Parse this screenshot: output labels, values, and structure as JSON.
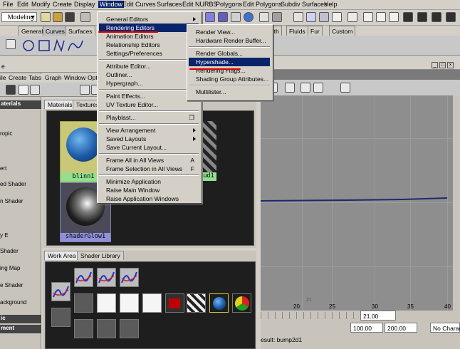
{
  "menubar": {
    "items": [
      "File",
      "Edit",
      "Modify",
      "Create",
      "Display",
      "Window",
      "Edit Curves",
      "Surfaces",
      "Edit NURBS",
      "Polygons",
      "Edit Polygons",
      "Subdiv Surfaces",
      "Help"
    ],
    "active_index": 5
  },
  "toolbar": {
    "mode": "Modeling"
  },
  "shelf_tabs": {
    "left": [
      "General",
      "Curves",
      "Surfaces"
    ],
    "right": [
      "oth",
      "Fluids",
      "Fur",
      "Custom"
    ],
    "selected_index": 1
  },
  "left_panel": {
    "header": "aterials",
    "items": [
      "ropic",
      "ert",
      "ed Shader",
      "n Shader",
      "y E",
      "Shader",
      "ing Map",
      "e Shader",
      "ackground"
    ],
    "footer1": "ic",
    "footer2": "ment"
  },
  "hypershade": {
    "menus": [
      "ile",
      "Create",
      "Tabs",
      "Graph",
      "Window",
      "Opt"
    ],
    "upper_tabs": [
      "Materials",
      "Textures"
    ],
    "lower_tabs": [
      "Work Area",
      "Shader Library"
    ],
    "swatches": {
      "blinn": "blinn1",
      "glow": "shaderGlow1",
      "partial": "ud1"
    }
  },
  "graph_editor": {
    "ticks": [
      "20",
      "25",
      "30",
      "35",
      "40"
    ],
    "tick_extra": "21",
    "frame_field": "21.00",
    "start": "100.00",
    "end": "200.00",
    "right_field": "No Charact",
    "status": "esult: bump2d1"
  },
  "window_menu": {
    "items": [
      {
        "label": "General Editors",
        "sub": true
      },
      {
        "label": "Rendering Editors",
        "sub": true,
        "hl": true
      },
      {
        "label": "Animation Editors",
        "sub": true
      },
      {
        "label": "Relationship Editors",
        "sub": true
      },
      {
        "label": "Settings/Preferences",
        "sub": true
      },
      {
        "sep": true
      },
      {
        "label": "Attribute Editor..."
      },
      {
        "label": "Outliner..."
      },
      {
        "label": "Hypergraph..."
      },
      {
        "sep": true
      },
      {
        "label": "Paint Effects..."
      },
      {
        "label": "UV Texture Editor..."
      },
      {
        "sep": true
      },
      {
        "label": "Playblast...",
        "box": true
      },
      {
        "sep": true
      },
      {
        "label": "View Arrangement",
        "sub": true
      },
      {
        "label": "Saved Layouts",
        "sub": true
      },
      {
        "label": "Save Current Layout..."
      },
      {
        "sep": true
      },
      {
        "label": "Frame All in All Views",
        "sc": "A"
      },
      {
        "label": "Frame Selection in All Views",
        "sc": "F"
      },
      {
        "sep": true
      },
      {
        "label": "Minimize Application"
      },
      {
        "label": "Raise Main Window"
      },
      {
        "label": "Raise Application Windows"
      }
    ]
  },
  "rendering_menu": {
    "items": [
      {
        "label": "Render View..."
      },
      {
        "label": "Hardware Render Buffer..."
      },
      {
        "sep": true
      },
      {
        "label": "Render Globals..."
      },
      {
        "label": "Hypershade...",
        "hl": true
      },
      {
        "label": "Rendering Flags..."
      },
      {
        "label": "Shading Group Attributes..."
      },
      {
        "sep": true
      },
      {
        "label": "Multilister..."
      }
    ]
  },
  "colors": {
    "highlight": "#0a246a",
    "annotation": "#e00000",
    "curve": "#1a2a6a"
  }
}
